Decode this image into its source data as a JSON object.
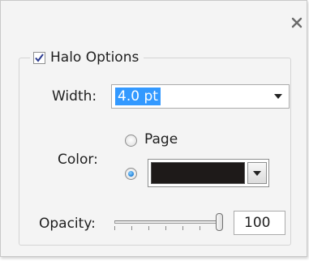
{
  "dialog": {
    "close_icon": "close-icon"
  },
  "halo": {
    "checkbox_label": "Halo Options",
    "checked": true
  },
  "width": {
    "label": "Width:",
    "value": "4.0 pt"
  },
  "color": {
    "label": "Color:",
    "page_option_label": "Page",
    "page_selected": false,
    "custom_selected": true,
    "swatch_color": "#1e1a19"
  },
  "opacity": {
    "label": "Opacity:",
    "value": "100",
    "level_percent": 100
  },
  "colors": {
    "selection": "#3399ff",
    "radio_accent": "#1f7fd8"
  }
}
